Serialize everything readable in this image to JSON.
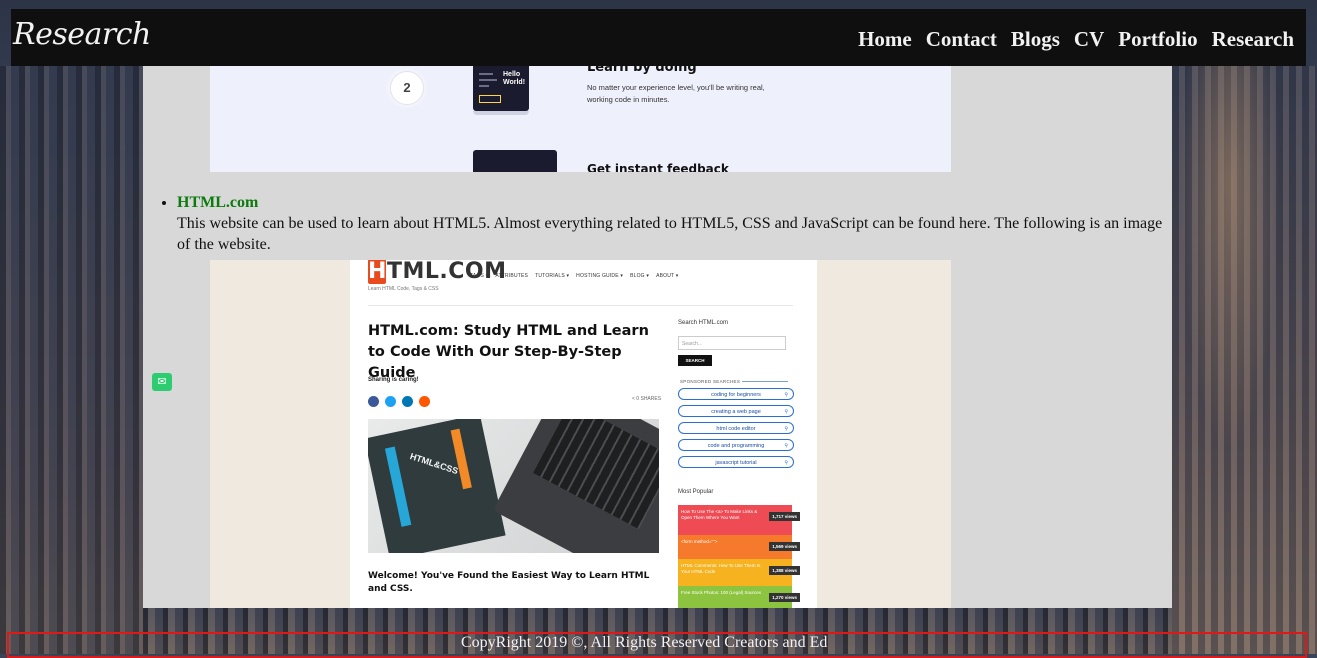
{
  "header": {
    "logo": "Research",
    "nav": [
      "Home",
      "Contact",
      "Blogs",
      "CV",
      "Portfolio",
      "Research"
    ]
  },
  "shot1": {
    "step_number": "2",
    "mini_code_text": "Hello\nWorld!",
    "learn_by_doing_title": "Learn by doing",
    "learn_by_doing_text": "No matter your experience level, you'll be writing real, working code in minutes.",
    "feedback_title": "Get instant feedback"
  },
  "entry": {
    "link_label": "HTML.com",
    "description": "This website can be used to learn about HTML5. Almost everything related to HTML5, CSS and JavaScript can be found here. The following is an image of the website."
  },
  "shot2": {
    "logo_h": "H",
    "logo_rest": "TML.COM",
    "tagline": "Learn HTML Code, Tags & CSS",
    "nav": [
      "TAGS ▾",
      "ATTRIBUTES",
      "TUTORIALS ▾",
      "HOSTING GUIDE ▾",
      "BLOG ▾",
      "ABOUT ▾"
    ],
    "headline": "HTML.com: Study HTML and Learn to Code With Our Step-By-Step Guide",
    "sharing": "Sharing is caring!",
    "shares": "< 0 SHARES",
    "book_title": "HTML&CSS",
    "welcome": "Welcome! You've Found the Easiest Way to Learn HTML and CSS.",
    "side": {
      "search_title": "Search HTML.com",
      "search_placeholder": "Search...",
      "search_button": "SEARCH",
      "sponsored_label": "SPONSORED SEARCHES",
      "pills": [
        "coding for beginners",
        "creating a web page",
        "html code editor",
        "code and programming",
        "javascript tutorial"
      ],
      "most_popular_title": "Most Popular",
      "most_popular": [
        {
          "text": "How To Use The <a> To Make Links & Open Them Where You Want",
          "views": "1,717 views",
          "color": "#ee4b55"
        },
        {
          "text": "<form method=\"\">",
          "views": "1,569 views",
          "color": "#f57a2b"
        },
        {
          "text": "HTML Comments: How To Use Them In Your HTML Code",
          "views": "1,388 views",
          "color": "#f6b21f"
        },
        {
          "text": "Free Stock Photos: 100 (Legal) Sources",
          "views": "1,270 views",
          "color": "#8cc43f"
        }
      ]
    }
  },
  "footer": {
    "text": "CopyRight 2019 ©, All Rights Reserved Creators and Ed"
  }
}
